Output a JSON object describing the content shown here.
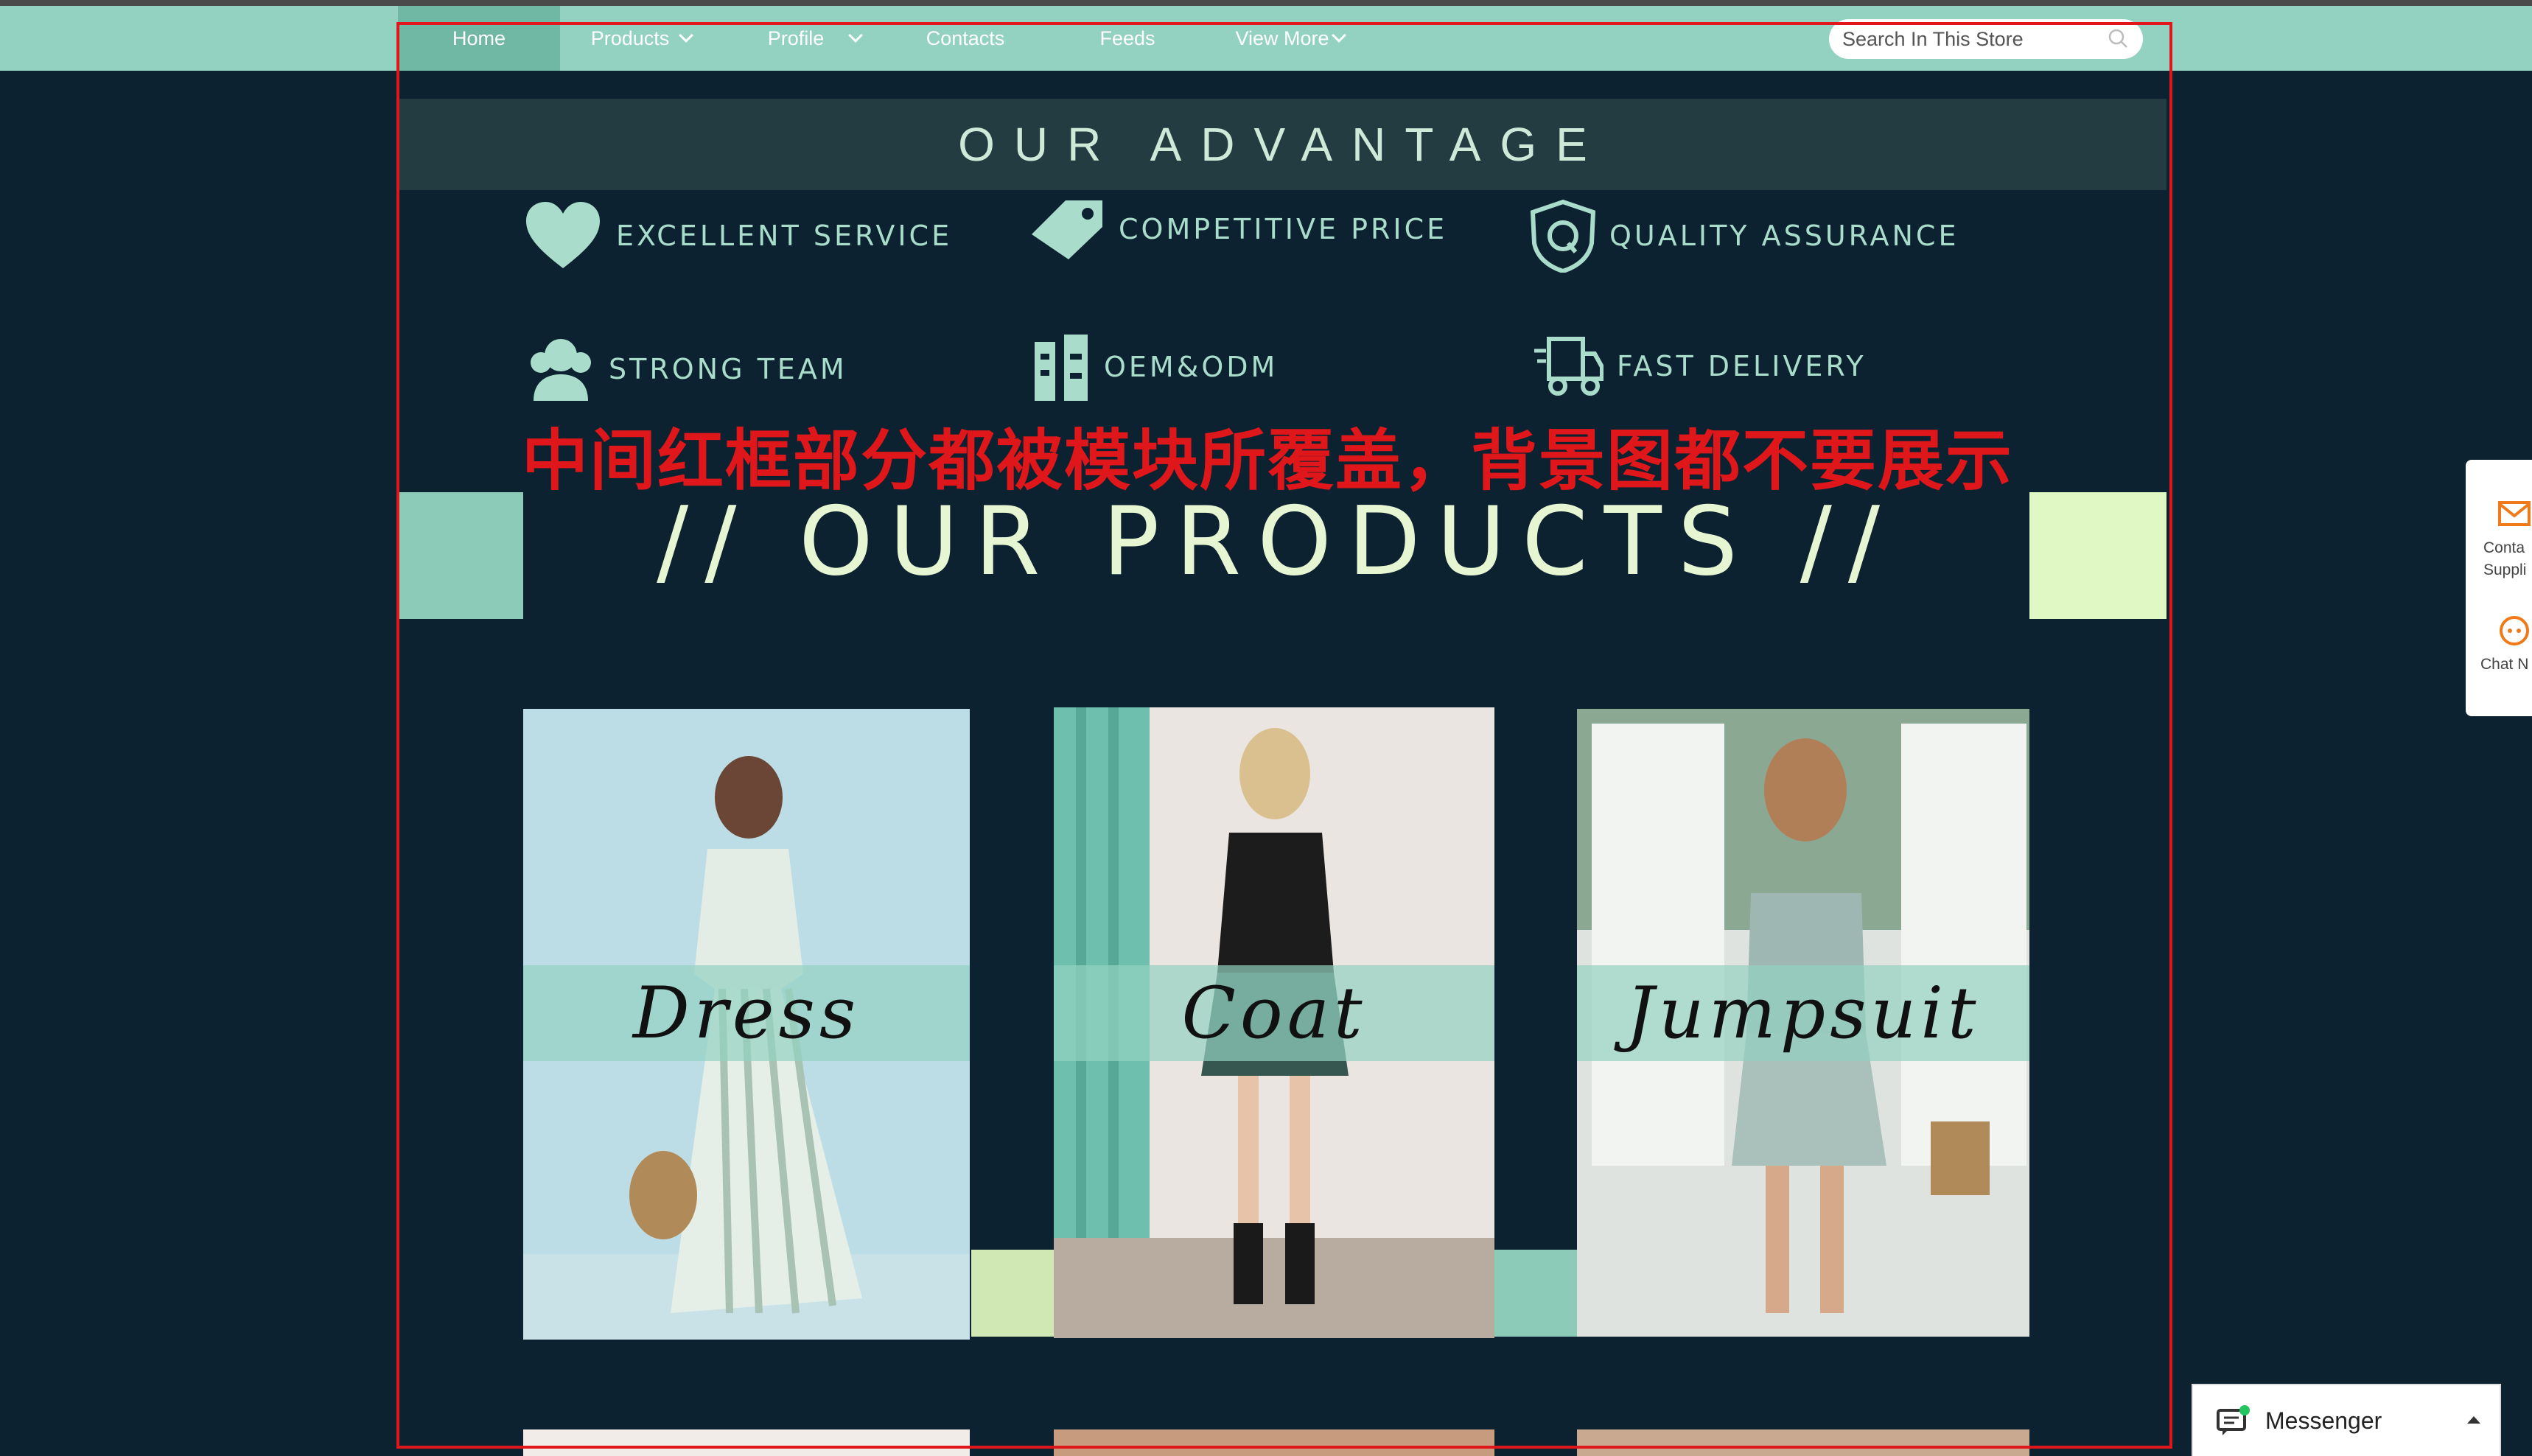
{
  "nav": {
    "items": [
      {
        "label": "Home",
        "active": true
      },
      {
        "label": "Products",
        "dropdown": true
      },
      {
        "label": "Profile",
        "dropdown": true
      },
      {
        "label": "Contacts"
      },
      {
        "label": "Feeds"
      },
      {
        "label": "View More",
        "dropdown": true
      }
    ],
    "search_placeholder": "Search In This Store"
  },
  "advantage": {
    "title": "OUR ADVANTAGE",
    "items": [
      {
        "label": "EXCELLENT SERVICE",
        "icon": "heart-icon"
      },
      {
        "label": "COMPETITIVE PRICE",
        "icon": "price-tag-icon"
      },
      {
        "label": "QUALITY ASSURANCE",
        "icon": "quality-shield-icon"
      },
      {
        "label": "STRONG TEAM",
        "icon": "team-icon"
      },
      {
        "label": "OEM&ODM",
        "icon": "factory-icon"
      },
      {
        "label": "FAST DELIVERY",
        "icon": "truck-icon"
      }
    ]
  },
  "annotation": "中间红框部分都被模块所覆盖，背景图都不要展示",
  "products": {
    "title": "// OUR PRODUCTS //",
    "cards": [
      {
        "label": "Dress"
      },
      {
        "label": "Coat"
      },
      {
        "label": "Jumpsuit"
      }
    ]
  },
  "side_panel": {
    "contact_label_1": "Conta",
    "contact_label_2": "Suppli",
    "chat_label": "Chat N"
  },
  "messenger": {
    "label": "Messenger"
  },
  "colors": {
    "nav_bg": "#93d2c0",
    "page_bg": "#0c2230",
    "accent_mint": "#8ccbb8",
    "accent_lime": "#e0f8c4",
    "annotation_red": "#e0171a",
    "side_icon_orange": "#f07a1a"
  }
}
